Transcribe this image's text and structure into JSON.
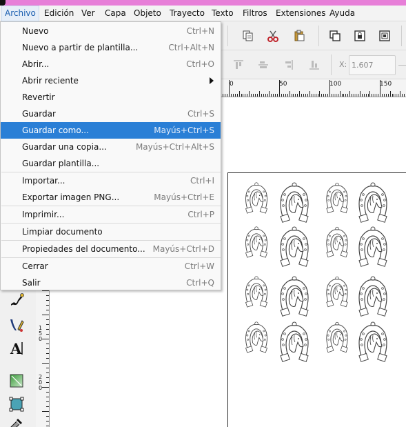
{
  "menubar": {
    "items": [
      {
        "label": "Archivo",
        "active": true
      },
      {
        "label": "Edición"
      },
      {
        "label": "Ver"
      },
      {
        "label": "Capa"
      },
      {
        "label": "Objeto"
      },
      {
        "label": "Trayecto"
      },
      {
        "label": "Texto"
      },
      {
        "label": "Filtros"
      },
      {
        "label": "Extensiones"
      },
      {
        "label": "Ayuda"
      }
    ]
  },
  "file_menu": {
    "items": [
      {
        "label": "Nuevo",
        "shortcut": "Ctrl+N"
      },
      {
        "label": "Nuevo a partir de plantilla...",
        "shortcut": "Ctrl+Alt+N"
      },
      {
        "label": "Abrir...",
        "shortcut": "Ctrl+O"
      },
      {
        "label": "Abrir reciente",
        "shortcut": ""
      },
      {
        "label": "Revertir",
        "shortcut": ""
      },
      {
        "label": "Guardar",
        "shortcut": "Ctrl+S"
      },
      {
        "label": "Guardar como...",
        "shortcut": "Mayús+Ctrl+S",
        "highlighted": true
      },
      {
        "label": "Guardar una copia...",
        "shortcut": "Mayús+Ctrl+Alt+S"
      },
      {
        "label": "Guardar plantilla...",
        "shortcut": ""
      },
      {
        "label": "Importar...",
        "shortcut": "Ctrl+I"
      },
      {
        "label": "Exportar imagen PNG...",
        "shortcut": "Mayús+Ctrl+E"
      },
      {
        "label": "Imprimir...",
        "shortcut": "Ctrl+P"
      },
      {
        "label": "Limpiar documento",
        "shortcut": ""
      },
      {
        "label": "Propiedades del documento...",
        "shortcut": "Mayús+Ctrl+D"
      },
      {
        "label": "Cerrar",
        "shortcut": "Ctrl+W"
      },
      {
        "label": "Salir",
        "shortcut": "Ctrl+Q"
      }
    ]
  },
  "toolcontrols": {
    "x_label": "X:",
    "x_value": "1.607"
  },
  "ruler": {
    "h_labels": [
      "0",
      "50",
      "100",
      "150"
    ],
    "v_labels": [
      "1",
      "5",
      "0",
      "2",
      "0",
      "0"
    ]
  },
  "colors": {
    "titlebar": "#e77fd8",
    "highlight": "#2a7fd6",
    "cut_icon": "#c0262d",
    "paste_icon": "#c99a3a"
  },
  "icons": {
    "toolbar": [
      "copy-icon",
      "cut-icon",
      "paste-icon",
      "group-icon",
      "lock-icon",
      "unlock-icon"
    ],
    "align": [
      "align-top-icon",
      "align-center-icon",
      "align-right-icon",
      "align-bottom-icon"
    ],
    "tools": [
      "calligraphy-icon",
      "bezier-pen-icon",
      "text-tool-icon",
      "gradient-tool-icon",
      "mesh-tool-icon",
      "dropper-icon"
    ],
    "drawing": "horseshoe-horse-icon"
  }
}
